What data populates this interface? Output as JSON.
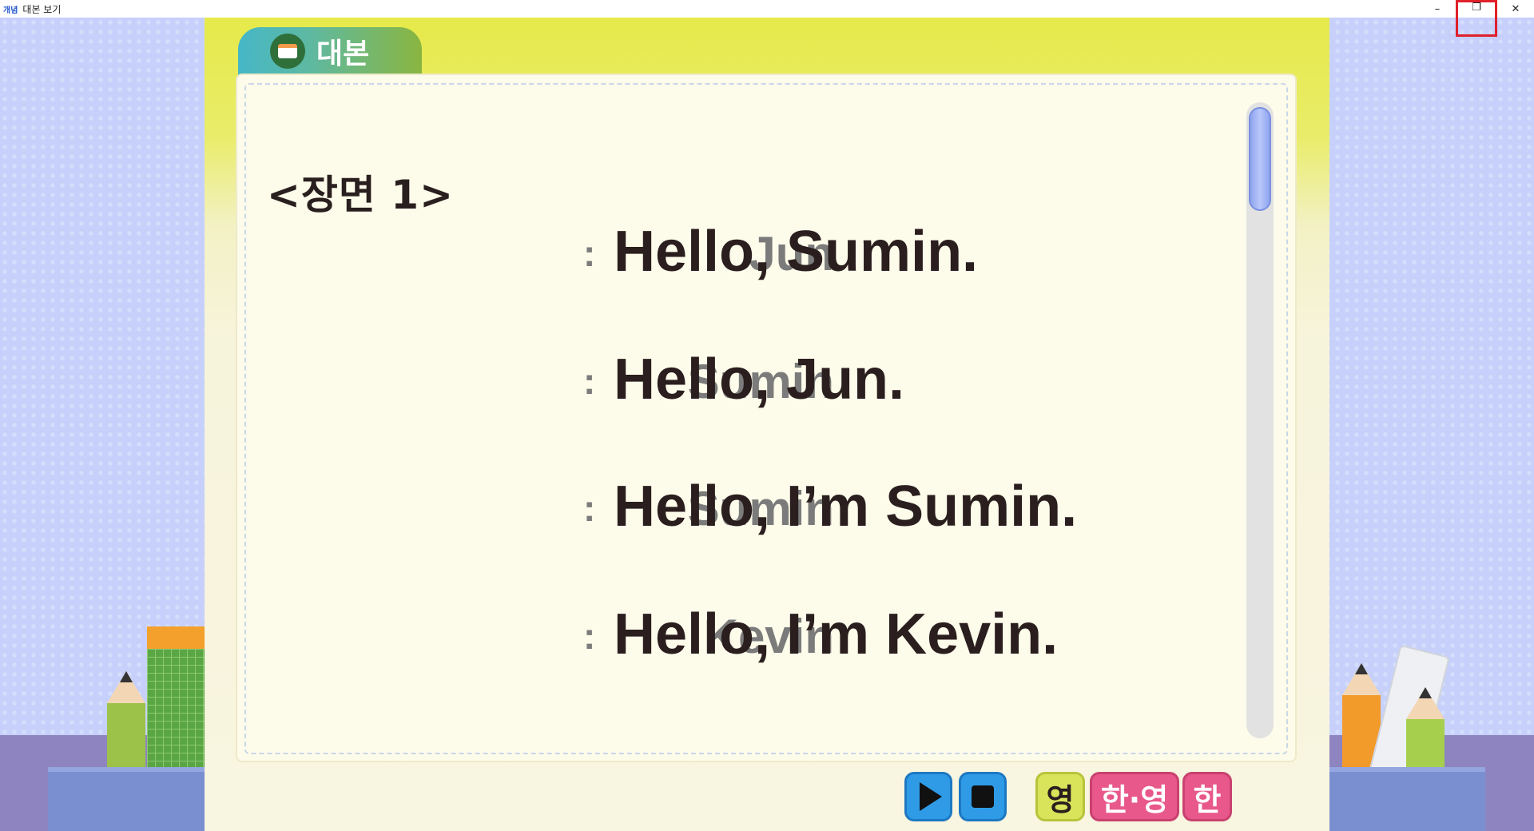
{
  "window": {
    "app_icon_text": "개념",
    "title": "대본 보기",
    "minimize_glyph": "–",
    "restore_glyph": "❐",
    "close_glyph": "✕"
  },
  "tab": {
    "label": "대본",
    "icon": "script-book-icon"
  },
  "script": {
    "scene_title": "<장면 1>",
    "lines": [
      {
        "speaker": "Jun",
        "text": "Hello, Sumin."
      },
      {
        "speaker": "Sumin",
        "text": "Hello, Jun."
      },
      {
        "speaker": "Sumin",
        "text": "Hello, I’m Sumin."
      },
      {
        "speaker": "Kevin",
        "text": "Hello, I’m Kevin."
      }
    ],
    "colon": ":"
  },
  "controls": {
    "play_icon": "play-icon",
    "stop_icon": "stop-icon",
    "english_label": "영",
    "korean_english_label": "한·영",
    "korean_label": "한"
  },
  "colors": {
    "play_stop": "#2f9be6",
    "english_button": "#d9e45a",
    "korean_buttons": "#e8588a",
    "tab_gradient_start": "#45b7c7",
    "tab_gradient_end": "#8ab540",
    "highlight": "#e0202a"
  }
}
